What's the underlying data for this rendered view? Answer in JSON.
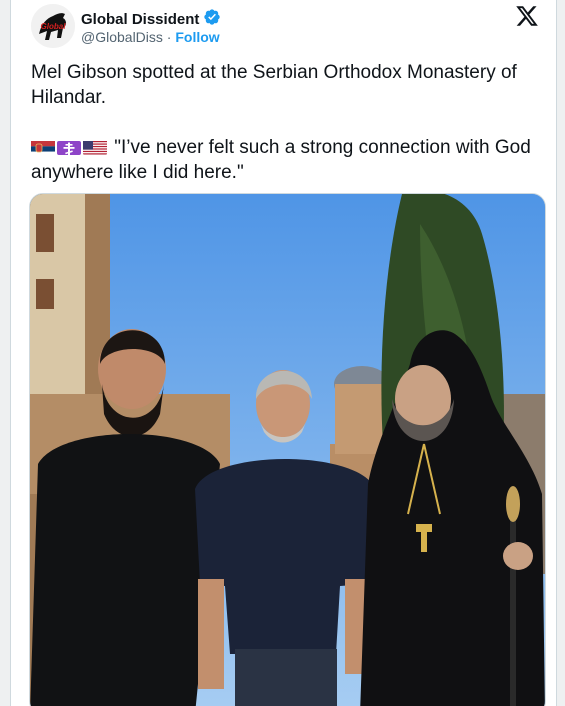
{
  "author": {
    "display_name": "Global Dissident",
    "handle": "@GlobalDiss",
    "follow_label": "Follow",
    "verified": true,
    "separator": "·"
  },
  "platform_logo": "x-logo-icon",
  "tweet": {
    "line1": "Mel Gibson spotted at the Serbian Orthodox Monastery of Hilandar.",
    "flags": [
      "serbia-flag-icon",
      "orthodox-cross-icon",
      "us-flag-icon"
    ],
    "quote": "\"I’ve never felt such a strong connection with God anywhere like I did here.\""
  },
  "colors": {
    "accent": "#1d9bf0",
    "text": "#0f1419",
    "muted": "#536471"
  },
  "media": {
    "alt": "Three men standing in front of a monastery: a bearded man in a black cassock, Mel Gibson in a navy polo, and an Orthodox bishop in black robes holding a staff"
  }
}
